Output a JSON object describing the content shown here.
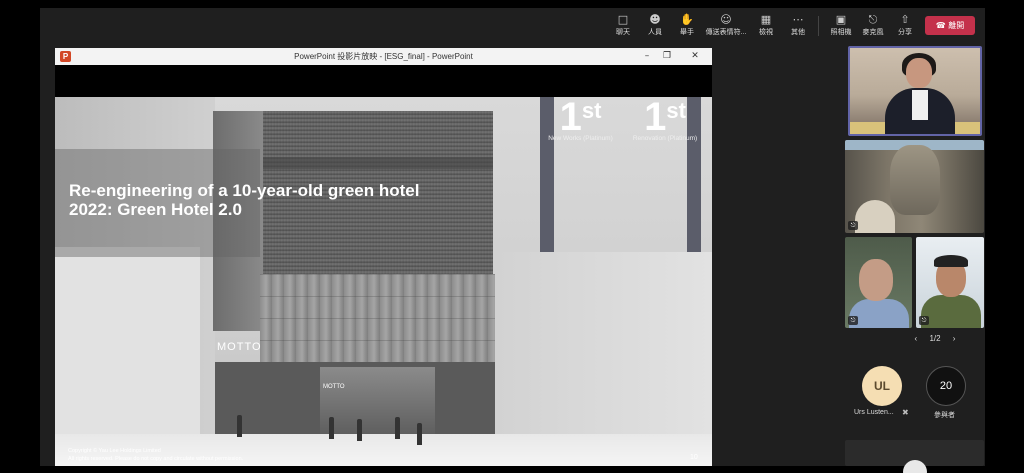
{
  "toolbar": {
    "chat": {
      "icon": "chat-icon",
      "label": "聊天"
    },
    "people": {
      "icon": "people-icon",
      "label": "人員"
    },
    "raise_hand": {
      "icon": "hand-icon",
      "label": "舉手"
    },
    "reactions": {
      "icon": "emoji-icon",
      "label": "傳送表情符..."
    },
    "view": {
      "icon": "grid-icon",
      "label": "檢視"
    },
    "more": {
      "icon": "more-icon",
      "label": "其他"
    },
    "camera": {
      "icon": "camera-icon",
      "label": "照相機"
    },
    "mic": {
      "icon": "microphone-icon",
      "label": "麥克風"
    },
    "share": {
      "icon": "share-icon",
      "label": "分享"
    },
    "leave": {
      "icon": "phone-icon",
      "label": "離開",
      "color": "#c4314b"
    }
  },
  "ppt": {
    "window_title": "PowerPoint 投影片放映 - [ESG_final] - PowerPoint",
    "logo_letter": "P"
  },
  "slide": {
    "title_line1": "Re-engineering of a 10-year-old green hotel",
    "title_line2": "2022: Green Hotel 2.0",
    "rank1": {
      "number": "1",
      "suffix": "st",
      "caption": "New Works (Platinum)"
    },
    "rank2": {
      "number": "1",
      "suffix": "st",
      "caption": "Renovation (Platinum)"
    },
    "building_logo": "MOTTO",
    "copyright_line1": "Copyright © Yau Lee Holdings Limited",
    "copyright_line2": "All rights reserved. Please do not copy and circulate without permission.",
    "page_number": "10"
  },
  "participants": {
    "pager": "1/2",
    "attendee_initials": "UL",
    "attendee_name": "Urs Lusten...",
    "attendee_count": "20",
    "attendee_count_label": "參與者"
  }
}
